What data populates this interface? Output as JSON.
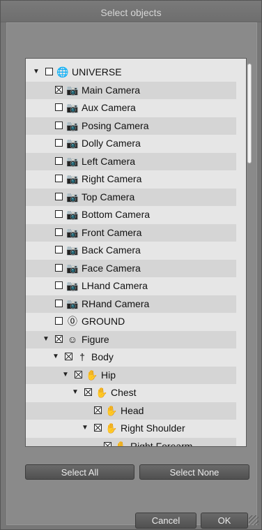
{
  "window": {
    "title": "Select objects"
  },
  "tree": {
    "rows": [
      {
        "label": "UNIVERSE",
        "expanded": true,
        "checked": false,
        "icon": "globe-icon",
        "glyph": "🌐"
      },
      {
        "label": "Main Camera",
        "checked": true,
        "icon": "camera-icon",
        "glyph": "📷"
      },
      {
        "label": "Aux Camera",
        "checked": false,
        "icon": "camera-icon",
        "glyph": "📷"
      },
      {
        "label": "Posing Camera",
        "checked": false,
        "icon": "camera-icon",
        "glyph": "📷"
      },
      {
        "label": "Dolly Camera",
        "checked": false,
        "icon": "camera-icon",
        "glyph": "📷"
      },
      {
        "label": "Left Camera",
        "checked": false,
        "icon": "camera-icon",
        "glyph": "📷"
      },
      {
        "label": "Right Camera",
        "checked": false,
        "icon": "camera-icon",
        "glyph": "📷"
      },
      {
        "label": "Top Camera",
        "checked": false,
        "icon": "camera-icon",
        "glyph": "📷"
      },
      {
        "label": "Bottom Camera",
        "checked": false,
        "icon": "camera-icon",
        "glyph": "📷"
      },
      {
        "label": "Front Camera",
        "checked": false,
        "icon": "camera-icon",
        "glyph": "📷"
      },
      {
        "label": "Back Camera",
        "checked": false,
        "icon": "camera-icon",
        "glyph": "📷"
      },
      {
        "label": "Face Camera",
        "checked": false,
        "icon": "camera-icon",
        "glyph": "📷"
      },
      {
        "label": "LHand Camera",
        "checked": false,
        "icon": "camera-icon",
        "glyph": "📷"
      },
      {
        "label": "RHand Camera",
        "checked": false,
        "icon": "camera-icon",
        "glyph": "📷"
      },
      {
        "label": "GROUND",
        "checked": false,
        "icon": "ground-icon",
        "glyph": "⓪"
      },
      {
        "label": "Figure",
        "expanded": true,
        "checked": true,
        "icon": "figure-icon",
        "glyph": "☺"
      },
      {
        "label": "Body",
        "expanded": true,
        "checked": true,
        "icon": "body-icon",
        "glyph": "†"
      },
      {
        "label": "Hip",
        "expanded": true,
        "checked": true,
        "icon": "bodypart-icon",
        "glyph": "✋"
      },
      {
        "label": "Chest",
        "expanded": true,
        "checked": true,
        "icon": "bodypart-icon",
        "glyph": "✋"
      },
      {
        "label": "Head",
        "checked": true,
        "icon": "bodypart-icon",
        "glyph": "✋"
      },
      {
        "label": "Right Shoulder",
        "expanded": true,
        "checked": true,
        "icon": "bodypart-icon",
        "glyph": "✋"
      },
      {
        "label": "Right Forearm",
        "checked": true,
        "icon": "bodypart-icon",
        "glyph": "✋"
      }
    ]
  },
  "buttons": {
    "select_all": "Select All",
    "select_none": "Select None",
    "cancel": "Cancel",
    "ok": "OK"
  },
  "colors": {
    "background": "#777777",
    "tree_background": "#e6e6e6",
    "tree_alt_row": "#d5d5d5",
    "button": "#5a5a5a",
    "title_text": "#d6d6d6"
  }
}
